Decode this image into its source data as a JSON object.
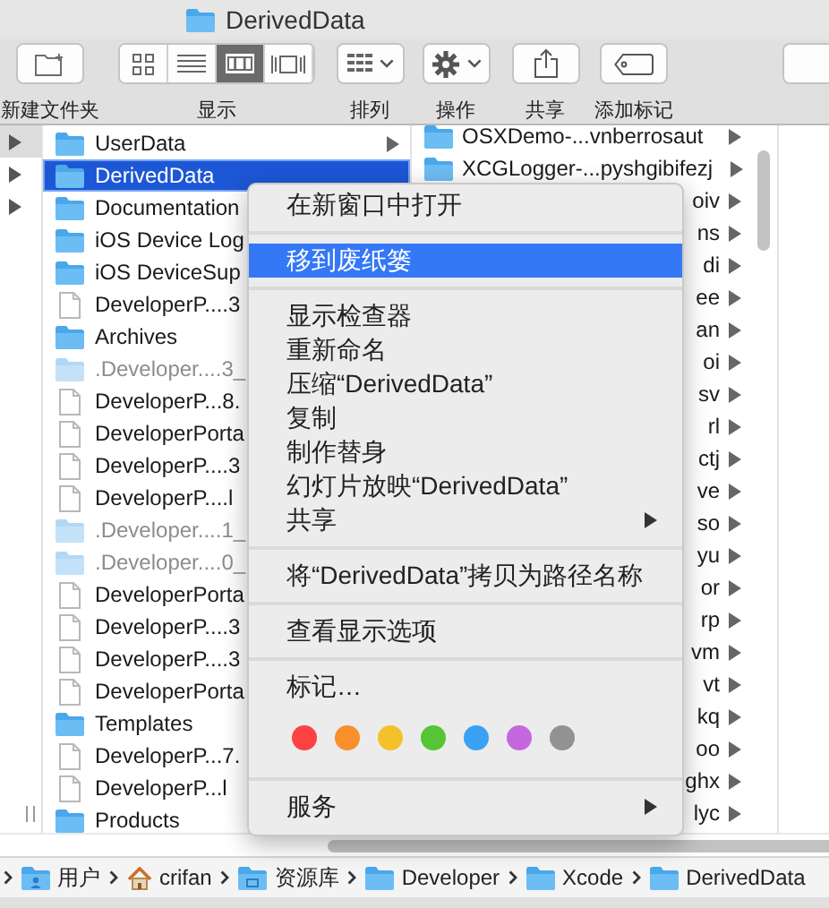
{
  "window": {
    "title": "DerivedData"
  },
  "toolbar": {
    "groups": [
      {
        "kind": "new-folder",
        "label": "新建文件夹"
      },
      {
        "kind": "view",
        "label": "显示",
        "segments": [
          {
            "kind": "icons",
            "selected": false
          },
          {
            "kind": "list",
            "selected": false
          },
          {
            "kind": "columns",
            "selected": true
          },
          {
            "kind": "coverflow",
            "selected": false
          }
        ]
      },
      {
        "kind": "arrange",
        "label": "排列"
      },
      {
        "kind": "action",
        "label": "操作"
      },
      {
        "kind": "share",
        "label": "共享"
      },
      {
        "kind": "tag",
        "label": "添加标记"
      },
      {
        "kind": "partial"
      }
    ]
  },
  "columns": [
    {
      "rows": [
        {
          "expandable": true,
          "selected": true
        },
        {
          "expandable": true,
          "selected": false
        },
        {
          "expandable": true,
          "selected": false
        }
      ]
    },
    {
      "rows": [
        {
          "kind": "folder",
          "name": "UserData",
          "expandable": true,
          "selected": false
        },
        {
          "kind": "folder",
          "name": "DerivedData",
          "expandable": false,
          "selected": true
        },
        {
          "kind": "folder",
          "name": "Documentation",
          "expandable": false,
          "selected": false
        },
        {
          "kind": "folder",
          "name": "iOS Device Log",
          "expandable": false,
          "selected": false
        },
        {
          "kind": "folder",
          "name": "iOS DeviceSup",
          "expandable": false,
          "selected": false
        },
        {
          "kind": "file",
          "name": "DeveloperP....3",
          "expandable": false,
          "selected": false
        },
        {
          "kind": "folder",
          "name": "Archives",
          "expandable": false,
          "selected": false
        },
        {
          "kind": "hidden-folder",
          "name": ".Developer....3_",
          "expandable": false,
          "selected": false
        },
        {
          "kind": "file",
          "name": "DeveloperP...8.",
          "expandable": false,
          "selected": false
        },
        {
          "kind": "file",
          "name": "DeveloperPorta",
          "expandable": false,
          "selected": false
        },
        {
          "kind": "file",
          "name": "DeveloperP....3",
          "expandable": false,
          "selected": false
        },
        {
          "kind": "file",
          "name": "DeveloperP....l",
          "expandable": false,
          "selected": false
        },
        {
          "kind": "hidden-folder",
          "name": ".Developer....1_",
          "expandable": false,
          "selected": false
        },
        {
          "kind": "hidden-folder",
          "name": ".Developer....0_",
          "expandable": false,
          "selected": false
        },
        {
          "kind": "file",
          "name": "DeveloperPorta",
          "expandable": false,
          "selected": false
        },
        {
          "kind": "file",
          "name": "DeveloperP....3",
          "expandable": false,
          "selected": false
        },
        {
          "kind": "file",
          "name": "DeveloperP....3",
          "expandable": false,
          "selected": false
        },
        {
          "kind": "file",
          "name": "DeveloperPorta",
          "expandable": false,
          "selected": false
        },
        {
          "kind": "folder",
          "name": "Templates",
          "expandable": false,
          "selected": false
        },
        {
          "kind": "file",
          "name": "DeveloperP...7.",
          "expandable": false,
          "selected": false
        },
        {
          "kind": "file",
          "name": "DeveloperP...l",
          "expandable": false,
          "selected": false
        },
        {
          "kind": "folder",
          "name": "Products",
          "expandable": false,
          "selected": false
        }
      ]
    },
    {
      "rows": [
        {
          "kind": "folder",
          "name": "OSXDemo-...vnberrosaut",
          "expandable": true
        },
        {
          "kind": "folder",
          "name": "XCGLogger-...pyshgibifezj",
          "expandable": true
        },
        {
          "kind": "partial",
          "name": "oiv",
          "expandable": true
        },
        {
          "kind": "partial",
          "name": "ns",
          "expandable": true
        },
        {
          "kind": "partial",
          "name": "di",
          "expandable": true
        },
        {
          "kind": "partial",
          "name": "ee",
          "expandable": true
        },
        {
          "kind": "partial",
          "name": "an",
          "expandable": true
        },
        {
          "kind": "partial",
          "name": "oi",
          "expandable": true
        },
        {
          "kind": "partial",
          "name": "sv",
          "expandable": true
        },
        {
          "kind": "partial",
          "name": "rl",
          "expandable": true
        },
        {
          "kind": "partial",
          "name": "ctj",
          "expandable": true
        },
        {
          "kind": "partial",
          "name": "ve",
          "expandable": true
        },
        {
          "kind": "partial",
          "name": "so",
          "expandable": true
        },
        {
          "kind": "partial",
          "name": "yu",
          "expandable": true
        },
        {
          "kind": "partial",
          "name": "or",
          "expandable": true
        },
        {
          "kind": "partial",
          "name": "rp",
          "expandable": true
        },
        {
          "kind": "partial",
          "name": "vm",
          "expandable": true
        },
        {
          "kind": "partial",
          "name": "vt",
          "expandable": true
        },
        {
          "kind": "partial",
          "name": "kq",
          "expandable": true
        },
        {
          "kind": "partial",
          "name": "oo",
          "expandable": true
        },
        {
          "kind": "partial",
          "name": "ghx",
          "expandable": true
        },
        {
          "kind": "partial",
          "name": "lyc",
          "expandable": true
        }
      ]
    }
  ],
  "context_menu": {
    "items": [
      {
        "kind": "item",
        "label": "在新窗口中打开",
        "selected": false,
        "submenu": false
      },
      {
        "kind": "separator"
      },
      {
        "kind": "item",
        "label": "移到废纸篓",
        "selected": true,
        "submenu": false
      },
      {
        "kind": "separator"
      },
      {
        "kind": "item",
        "label": "显示检查器",
        "selected": false,
        "submenu": false
      },
      {
        "kind": "item",
        "label": "重新命名",
        "selected": false,
        "submenu": false
      },
      {
        "kind": "item",
        "label": "压缩“DerivedData”",
        "selected": false,
        "submenu": false
      },
      {
        "kind": "item",
        "label": "复制",
        "selected": false,
        "submenu": false
      },
      {
        "kind": "item",
        "label": "制作替身",
        "selected": false,
        "submenu": false
      },
      {
        "kind": "item",
        "label": "幻灯片放映“DerivedData”",
        "selected": false,
        "submenu": false
      },
      {
        "kind": "item",
        "label": "共享",
        "selected": false,
        "submenu": true
      },
      {
        "kind": "separator"
      },
      {
        "kind": "item",
        "label": "将“DerivedData”拷贝为路径名称",
        "selected": false,
        "submenu": false
      },
      {
        "kind": "separator"
      },
      {
        "kind": "item",
        "label": "查看显示选项",
        "selected": false,
        "submenu": false
      },
      {
        "kind": "separator"
      },
      {
        "kind": "item",
        "label": "标记…",
        "selected": false,
        "submenu": false
      },
      {
        "kind": "tags",
        "colors": [
          {
            "color": "#fc4242"
          },
          {
            "color": "#f7902a"
          },
          {
            "color": "#f4c12c"
          },
          {
            "color": "#55c535"
          },
          {
            "color": "#3aa1f4"
          },
          {
            "color": "#c568dd"
          },
          {
            "color": "#929292"
          }
        ]
      },
      {
        "kind": "separator"
      },
      {
        "kind": "item",
        "label": "服务",
        "selected": false,
        "submenu": true
      }
    ]
  },
  "path_bar": {
    "items": [
      {
        "kind": "user",
        "label": "用户"
      },
      {
        "kind": "home",
        "label": "crifan"
      },
      {
        "kind": "library",
        "label": "资源库"
      },
      {
        "kind": "folder",
        "label": "Developer"
      },
      {
        "kind": "folder",
        "label": "Xcode"
      },
      {
        "kind": "folder",
        "label": "DerivedData"
      }
    ]
  }
}
